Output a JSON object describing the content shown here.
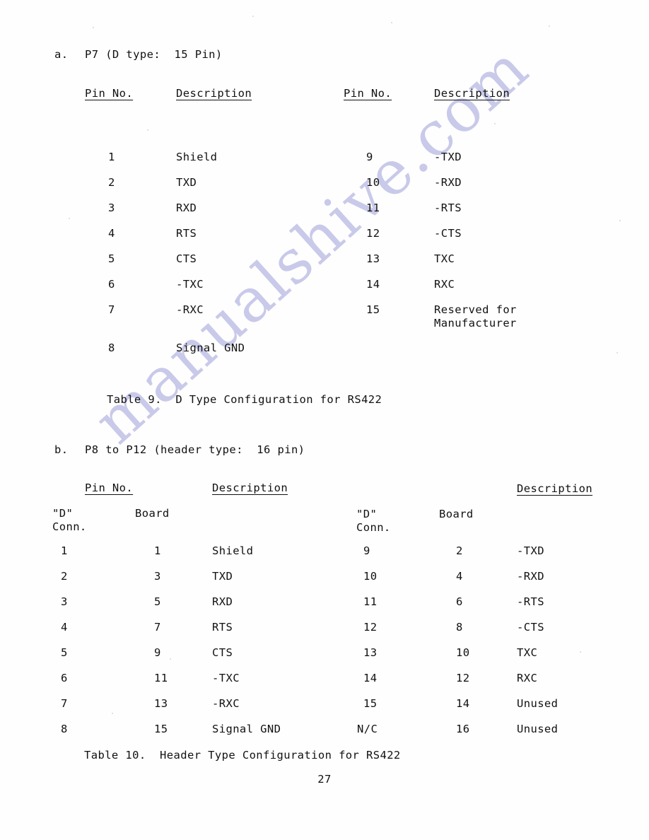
{
  "document": {
    "page_number": "27",
    "watermark": "manualshive.com",
    "watermark_color": "#c9c9ea",
    "ink_color": "#111111",
    "paper_color": "#fefefe"
  },
  "section_a": {
    "label": "a.",
    "title": "P7 (D type:  15 Pin)",
    "headers": {
      "pin_no_left": "Pin No.",
      "description_left": "Description",
      "pin_no_right": "Pin No.",
      "description_right": "Description"
    },
    "columns": [
      "Pin No.",
      "Description"
    ],
    "rows_left": [
      {
        "pin": "1",
        "description": "Shield"
      },
      {
        "pin": "2",
        "description": "TXD"
      },
      {
        "pin": "3",
        "description": "RXD"
      },
      {
        "pin": "4",
        "description": "RTS"
      },
      {
        "pin": "5",
        "description": "CTS"
      },
      {
        "pin": "6",
        "description": "-TXC"
      },
      {
        "pin": "7",
        "description": "-RXC"
      },
      {
        "pin": "8",
        "description": "Signal GND"
      }
    ],
    "rows_right": [
      {
        "pin": "9",
        "description": "-TXD"
      },
      {
        "pin": "10",
        "description": "-RXD"
      },
      {
        "pin": "11",
        "description": "-RTS"
      },
      {
        "pin": "12",
        "description": "-CTS"
      },
      {
        "pin": "13",
        "description": "TXC"
      },
      {
        "pin": "14",
        "description": "RXC"
      },
      {
        "pin": "15",
        "description": "Reserved for\nManufacturer"
      }
    ],
    "caption": "Table 9.  D Type Configuration for RS422"
  },
  "section_b": {
    "label": "b.",
    "title": "P8 to P12 (header type:  16 pin)",
    "headers": {
      "pin_no_left": "Pin No.",
      "description_left": "Description",
      "description_right": "Description"
    },
    "subheaders": {
      "d_conn_left_line1": "\"D\"",
      "d_conn_left_line2": "Conn.",
      "board_left": "Board",
      "d_conn_right_line1": "\"D\"",
      "d_conn_right_line2": "Conn.",
      "board_right": "Board"
    },
    "rows_left": [
      {
        "d_conn": "1",
        "board": "1",
        "description": "Shield"
      },
      {
        "d_conn": "2",
        "board": "3",
        "description": "TXD"
      },
      {
        "d_conn": "3",
        "board": "5",
        "description": "RXD"
      },
      {
        "d_conn": "4",
        "board": "7",
        "description": "RTS"
      },
      {
        "d_conn": "5",
        "board": "9",
        "description": "CTS"
      },
      {
        "d_conn": "6",
        "board": "11",
        "description": "-TXC"
      },
      {
        "d_conn": "7",
        "board": "13",
        "description": "-RXC"
      },
      {
        "d_conn": "8",
        "board": "15",
        "description": "Signal GND"
      }
    ],
    "rows_right": [
      {
        "d_conn": "9",
        "board": "2",
        "description": "-TXD"
      },
      {
        "d_conn": "10",
        "board": "4",
        "description": "-RXD"
      },
      {
        "d_conn": "11",
        "board": "6",
        "description": "-RTS"
      },
      {
        "d_conn": "12",
        "board": "8",
        "description": "-CTS"
      },
      {
        "d_conn": "13",
        "board": "10",
        "description": "TXC"
      },
      {
        "d_conn": "14",
        "board": "12",
        "description": "RXC"
      },
      {
        "d_conn": "15",
        "board": "14",
        "description": "Unused"
      },
      {
        "d_conn": "N/C",
        "board": "16",
        "description": "Unused"
      }
    ],
    "caption": "Table 10.  Header Type Configuration for RS422"
  }
}
